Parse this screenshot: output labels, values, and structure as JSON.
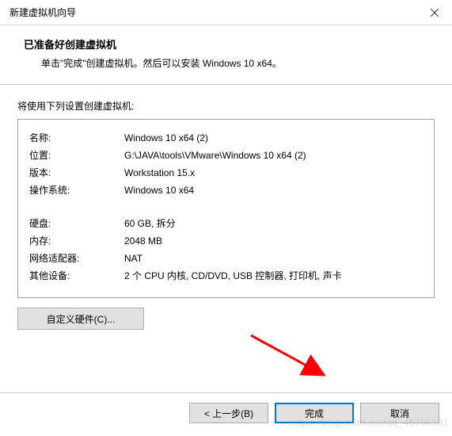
{
  "window": {
    "title": "新建虚拟机向导"
  },
  "header": {
    "title": "已准备好创建虚拟机",
    "subtitle": "单击\"完成\"创建虚拟机。然后可以安装 Windows 10 x64。"
  },
  "content": {
    "label": "将使用下列设置创建虚拟机:"
  },
  "settings": {
    "rows1": [
      {
        "key": "名称:",
        "value": "Windows 10 x64 (2)"
      },
      {
        "key": "位置:",
        "value": "G:\\JAVA\\tools\\VMware\\Windows 10 x64 (2)"
      },
      {
        "key": "版本:",
        "value": "Workstation 15.x"
      },
      {
        "key": "操作系统:",
        "value": "Windows 10 x64"
      }
    ],
    "rows2": [
      {
        "key": "硬盘:",
        "value": "60 GB, 拆分"
      },
      {
        "key": "内存:",
        "value": "2048 MB"
      },
      {
        "key": "网络适配器:",
        "value": "NAT"
      },
      {
        "key": "其他设备:",
        "value": "2 个 CPU 内核, CD/DVD, USB 控制器, 打印机, 声卡"
      }
    ]
  },
  "buttons": {
    "customize": "自定义硬件(C)...",
    "back": "< 上一步(B)",
    "finish": "完成",
    "cancel": "取消"
  },
  "watermark": "https://blog.csdn.net/qq_45705131"
}
